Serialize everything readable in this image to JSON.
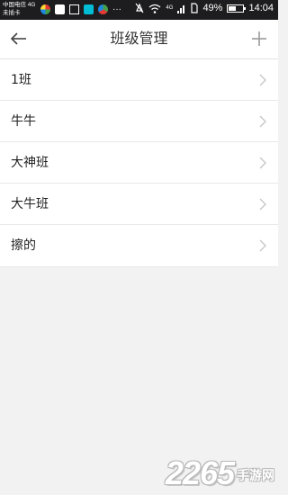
{
  "status_bar": {
    "carrier_line1": "中国电信 4G",
    "carrier_line2": "未插卡",
    "dots": "···",
    "network": "4G",
    "battery_text": "49%",
    "battery_level": 0.49,
    "time": "14:04"
  },
  "nav": {
    "title": "班级管理",
    "back_icon": "arrow-left-icon",
    "add_icon": "plus-icon"
  },
  "classes": [
    {
      "label": "1班"
    },
    {
      "label": "牛牛"
    },
    {
      "label": "大神班"
    },
    {
      "label": "大牛班"
    },
    {
      "label": "擦的"
    }
  ],
  "watermark": {
    "number": "2265",
    "text": "手游网"
  },
  "colors": {
    "status_bar_bg": "#1d1d1f",
    "nav_bg": "#ffffff",
    "page_bg": "#f2f2f2",
    "divider": "#e8e8e8",
    "chevron": "#c7c7c7",
    "title_text": "#333333"
  }
}
